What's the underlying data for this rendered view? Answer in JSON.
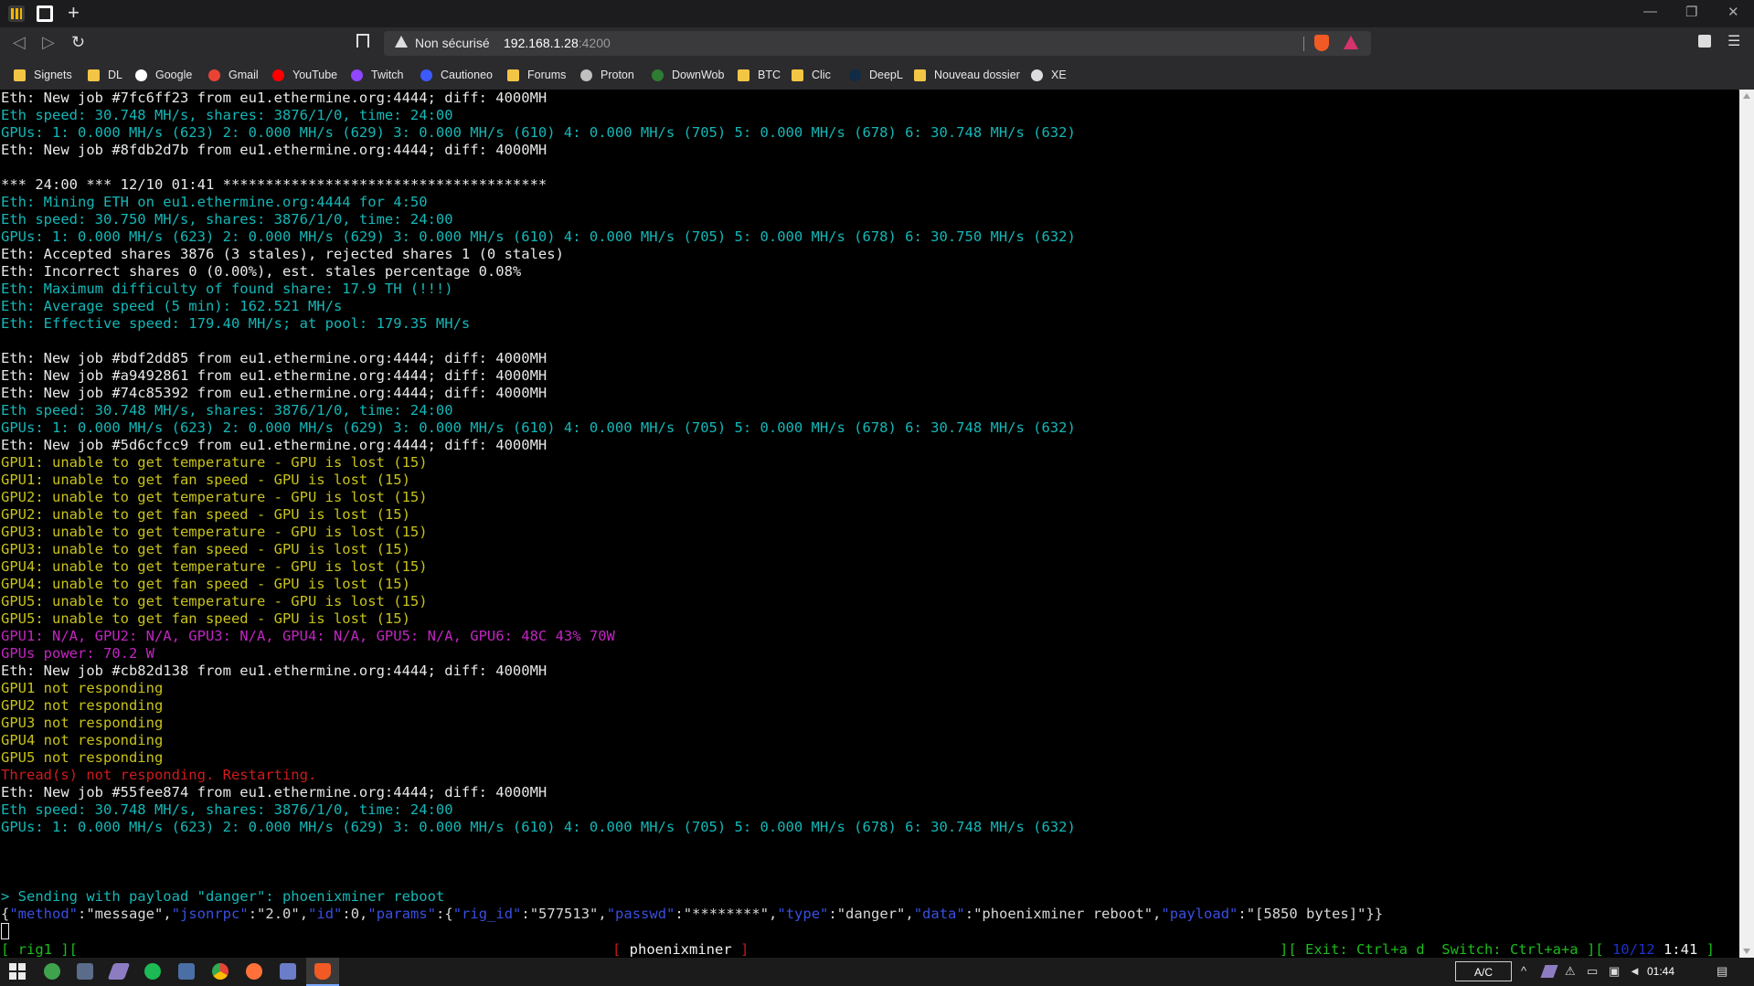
{
  "browser": {
    "security_label": "Non sécurisé",
    "url_host": "192.168.1.28",
    "url_port": ":4200"
  },
  "bookmarks": [
    {
      "label": "Signets",
      "icon": "folder-icon"
    },
    {
      "label": "DL",
      "icon": "folder-icon"
    },
    {
      "label": "Google",
      "icon": "google-icon"
    },
    {
      "label": "Gmail",
      "icon": "gmail-icon"
    },
    {
      "label": "YouTube",
      "icon": "youtube-icon"
    },
    {
      "label": "Twitch",
      "icon": "twitch-icon"
    },
    {
      "label": "Cautioneo",
      "icon": "cautioneo-icon"
    },
    {
      "label": "Forums",
      "icon": "folder-icon"
    },
    {
      "label": "Proton",
      "icon": "proton-icon"
    },
    {
      "label": "DownWob",
      "icon": "downwob-icon"
    },
    {
      "label": "BTC",
      "icon": "folder-icon"
    },
    {
      "label": "Clic",
      "icon": "folder-icon"
    },
    {
      "label": "DeepL",
      "icon": "deepl-icon"
    },
    {
      "label": "Nouveau dossier",
      "icon": "folder-icon"
    },
    {
      "label": "XE",
      "icon": "xe-icon"
    }
  ],
  "terminal": {
    "lines": [
      {
        "text": "Eth: New job #7fc6ff23 from eu1.ethermine.org:4444; diff: 4000MH",
        "color": "w"
      },
      {
        "text": "Eth speed: 30.748 MH/s, shares: 3876/1/0, time: 24:00",
        "color": "c"
      },
      {
        "text": "GPUs: 1: 0.000 MH/s (623) 2: 0.000 MH/s (629) 3: 0.000 MH/s (610) 4: 0.000 MH/s (705) 5: 0.000 MH/s (678) 6: 30.748 MH/s (632)",
        "color": "c"
      },
      {
        "text": "Eth: New job #8fdb2d7b from eu1.ethermine.org:4444; diff: 4000MH",
        "color": "w"
      },
      {
        "text": "",
        "color": "w"
      },
      {
        "text": "*** 24:00 *** 12/10 01:41 **************************************",
        "color": "w"
      },
      {
        "text": "Eth: Mining ETH on eu1.ethermine.org:4444 for 4:50",
        "color": "c"
      },
      {
        "text": "Eth speed: 30.750 MH/s, shares: 3876/1/0, time: 24:00",
        "color": "c"
      },
      {
        "text": "GPUs: 1: 0.000 MH/s (623) 2: 0.000 MH/s (629) 3: 0.000 MH/s (610) 4: 0.000 MH/s (705) 5: 0.000 MH/s (678) 6: 30.750 MH/s (632)",
        "color": "c"
      },
      {
        "text": "Eth: Accepted shares 3876 (3 stales), rejected shares 1 (0 stales)",
        "color": "w"
      },
      {
        "text": "Eth: Incorrect shares 0 (0.00%), est. stales percentage 0.08%",
        "color": "w"
      },
      {
        "text": "Eth: Maximum difficulty of found share: 17.9 TH (!!!)",
        "color": "c"
      },
      {
        "text": "Eth: Average speed (5 min): 162.521 MH/s",
        "color": "c"
      },
      {
        "text": "Eth: Effective speed: 179.40 MH/s; at pool: 179.35 MH/s",
        "color": "c"
      },
      {
        "text": "",
        "color": "w"
      },
      {
        "text": "Eth: New job #bdf2dd85 from eu1.ethermine.org:4444; diff: 4000MH",
        "color": "w"
      },
      {
        "text": "Eth: New job #a9492861 from eu1.ethermine.org:4444; diff: 4000MH",
        "color": "w"
      },
      {
        "text": "Eth: New job #74c85392 from eu1.ethermine.org:4444; diff: 4000MH",
        "color": "w"
      },
      {
        "text": "Eth speed: 30.748 MH/s, shares: 3876/1/0, time: 24:00",
        "color": "c"
      },
      {
        "text": "GPUs: 1: 0.000 MH/s (623) 2: 0.000 MH/s (629) 3: 0.000 MH/s (610) 4: 0.000 MH/s (705) 5: 0.000 MH/s (678) 6: 30.748 MH/s (632)",
        "color": "c"
      },
      {
        "text": "Eth: New job #5d6cfcc9 from eu1.ethermine.org:4444; diff: 4000MH",
        "color": "w"
      },
      {
        "text": "GPU1: unable to get temperature - GPU is lost (15)",
        "color": "y"
      },
      {
        "text": "GPU1: unable to get fan speed - GPU is lost (15)",
        "color": "y"
      },
      {
        "text": "GPU2: unable to get temperature - GPU is lost (15)",
        "color": "y"
      },
      {
        "text": "GPU2: unable to get fan speed - GPU is lost (15)",
        "color": "y"
      },
      {
        "text": "GPU3: unable to get temperature - GPU is lost (15)",
        "color": "y"
      },
      {
        "text": "GPU3: unable to get fan speed - GPU is lost (15)",
        "color": "y"
      },
      {
        "text": "GPU4: unable to get temperature - GPU is lost (15)",
        "color": "y"
      },
      {
        "text": "GPU4: unable to get fan speed - GPU is lost (15)",
        "color": "y"
      },
      {
        "text": "GPU5: unable to get temperature - GPU is lost (15)",
        "color": "y"
      },
      {
        "text": "GPU5: unable to get fan speed - GPU is lost (15)",
        "color": "y"
      },
      {
        "text": "GPU1: N/A, GPU2: N/A, GPU3: N/A, GPU4: N/A, GPU5: N/A, GPU6: 48C 43% 70W",
        "color": "m"
      },
      {
        "text": "GPUs power: 70.2 W",
        "color": "m"
      },
      {
        "text": "Eth: New job #cb82d138 from eu1.ethermine.org:4444; diff: 4000MH",
        "color": "w"
      },
      {
        "text": "GPU1 not responding",
        "color": "y"
      },
      {
        "text": "GPU2 not responding",
        "color": "y"
      },
      {
        "text": "GPU3 not responding",
        "color": "y"
      },
      {
        "text": "GPU4 not responding",
        "color": "y"
      },
      {
        "text": "GPU5 not responding",
        "color": "y"
      },
      {
        "text": "Thread(s) not responding. Restarting.",
        "color": "r"
      },
      {
        "text": "Eth: New job #55fee874 from eu1.ethermine.org:4444; diff: 4000MH",
        "color": "w"
      },
      {
        "text": "Eth speed: 30.748 MH/s, shares: 3876/1/0, time: 24:00",
        "color": "c"
      },
      {
        "text": "GPUs: 1: 0.000 MH/s (623) 2: 0.000 MH/s (629) 3: 0.000 MH/s (610) 4: 0.000 MH/s (705) 5: 0.000 MH/s (678) 6: 30.748 MH/s (632)",
        "color": "c"
      },
      {
        "text": "",
        "color": "w"
      },
      {
        "text": "",
        "color": "w"
      },
      {
        "text": "",
        "color": "w"
      },
      {
        "text": "> Sending with payload \"danger\": phoenixminer reboot",
        "color": "c"
      }
    ],
    "json_parts": [
      {
        "t": "{",
        "k": "val"
      },
      {
        "t": "\"method\"",
        "k": "key"
      },
      {
        "t": ":",
        "k": "val"
      },
      {
        "t": "\"message\"",
        "k": "val"
      },
      {
        "t": ",",
        "k": "val"
      },
      {
        "t": "\"jsonrpc\"",
        "k": "key"
      },
      {
        "t": ":",
        "k": "val"
      },
      {
        "t": "\"2.0\"",
        "k": "val"
      },
      {
        "t": ",",
        "k": "val"
      },
      {
        "t": "\"id\"",
        "k": "key"
      },
      {
        "t": ":0,",
        "k": "val"
      },
      {
        "t": "\"params\"",
        "k": "key"
      },
      {
        "t": ":{",
        "k": "val"
      },
      {
        "t": "\"rig_id\"",
        "k": "key"
      },
      {
        "t": ":",
        "k": "val"
      },
      {
        "t": "\"577513\"",
        "k": "val"
      },
      {
        "t": ",",
        "k": "val"
      },
      {
        "t": "\"passwd\"",
        "k": "key"
      },
      {
        "t": ":",
        "k": "val"
      },
      {
        "t": "\"********\"",
        "k": "val"
      },
      {
        "t": ",",
        "k": "val"
      },
      {
        "t": "\"type\"",
        "k": "key"
      },
      {
        "t": ":",
        "k": "val"
      },
      {
        "t": "\"danger\"",
        "k": "val"
      },
      {
        "t": ",",
        "k": "val"
      },
      {
        "t": "\"data\"",
        "k": "key"
      },
      {
        "t": ":",
        "k": "val"
      },
      {
        "t": "\"phoenixminer reboot\"",
        "k": "val"
      },
      {
        "t": ",",
        "k": "val"
      },
      {
        "t": "\"payload\"",
        "k": "key"
      },
      {
        "t": ":",
        "k": "val"
      },
      {
        "t": "\"[5850 bytes]\"",
        "k": "val"
      },
      {
        "t": "}}",
        "k": "val"
      }
    ],
    "status": {
      "left": "[ rig1 ][",
      "center_open": "[ ",
      "title": "phoenixminer",
      "center_close": " ]",
      "right_prefix": "][ Exit: Ctrl+a d  Switch: Ctrl+a+a ][ ",
      "load": "10/12",
      "clock": "1:41",
      "right_suffix": " ]"
    }
  },
  "colors": {
    "white": "#e8e8e8",
    "cyan": "#14b7b7",
    "yellow": "#c8c21a",
    "magenta": "#c225c2",
    "red": "#d01a1a",
    "status_green": "#1bbb1b",
    "json_key_blue": "#3a4fe0"
  },
  "taskbar": {
    "ime_label": "A/C",
    "time": "01:44"
  }
}
